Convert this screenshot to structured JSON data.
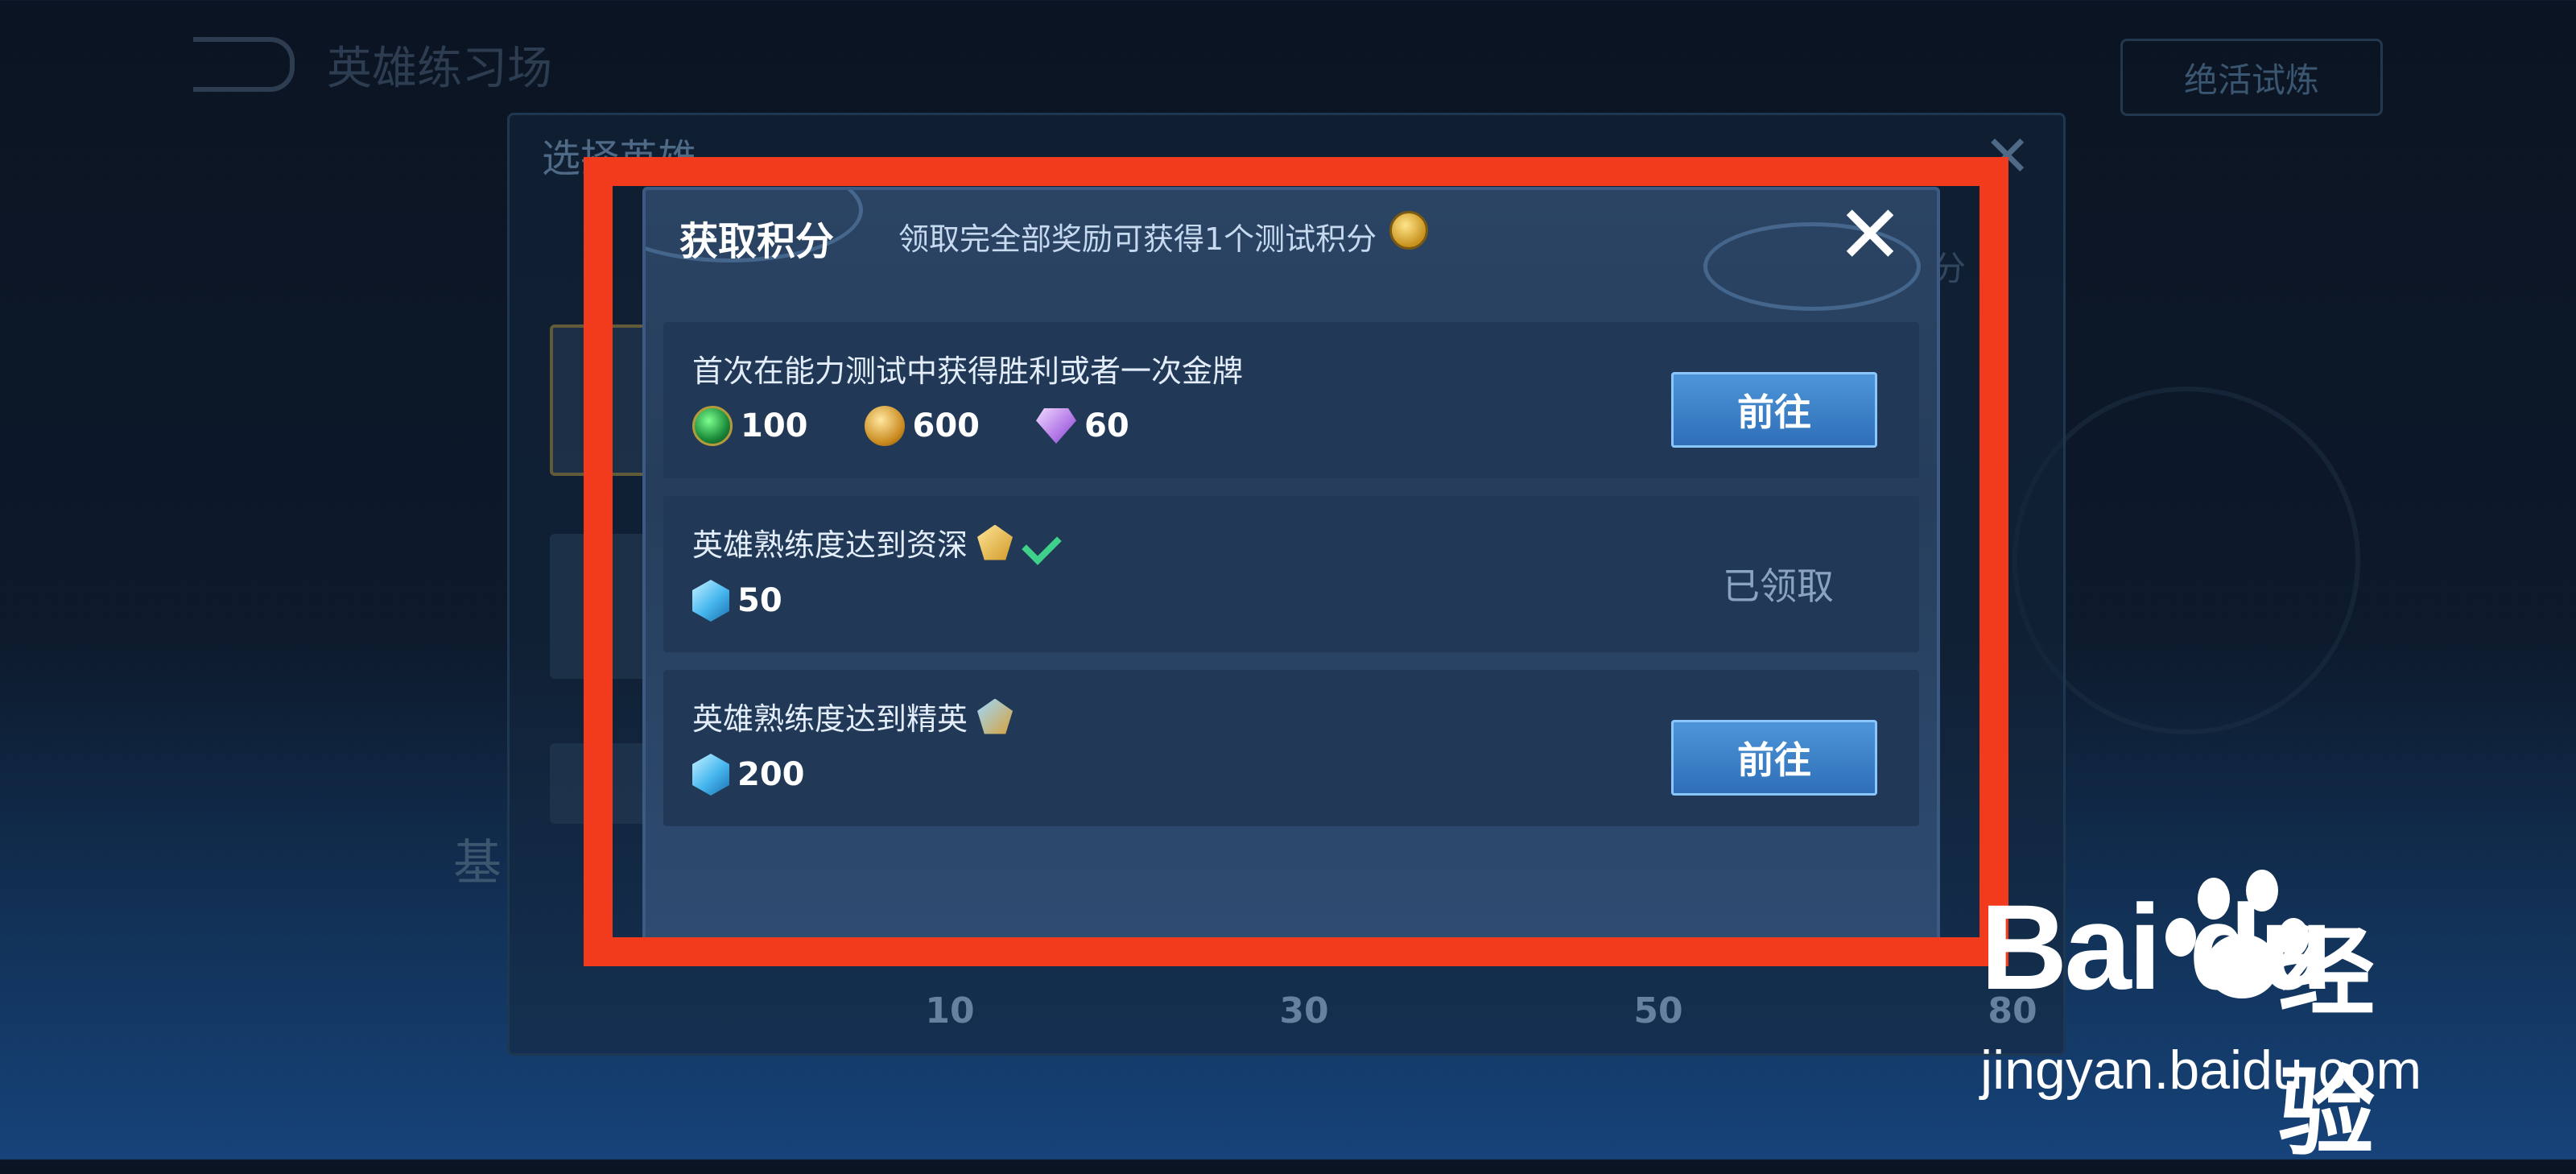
{
  "background": {
    "title": "英雄练习场",
    "top_right_button": "绝活试炼",
    "panel_title": "选择英雄",
    "panel_close": "✕",
    "side_label": "分",
    "bottom_label": "基",
    "progress_ticks": [
      "10",
      "30",
      "50",
      "80"
    ]
  },
  "dialog": {
    "title": "获取积分",
    "subtitle": "领取完全部奖励可获得1个测试积分",
    "close": "✕",
    "tasks": [
      {
        "text": "首次在能力测试中获得胜利或者一次金牌",
        "rewards": [
          {
            "icon": "green-gem-icon",
            "value": "100"
          },
          {
            "icon": "gold-coin-icon",
            "value": "600"
          },
          {
            "icon": "purple-diamond-icon",
            "value": "60"
          }
        ],
        "action": "前往",
        "status": "available"
      },
      {
        "text": "英雄熟练度达到资深",
        "rewards": [
          {
            "icon": "blue-cube-icon",
            "value": "50"
          }
        ],
        "action": "已领取",
        "status": "claimed",
        "completed": true
      },
      {
        "text": "英雄熟练度达到精英",
        "rewards": [
          {
            "icon": "blue-cube-icon",
            "value": "200"
          }
        ],
        "action": "前往",
        "status": "available"
      }
    ]
  },
  "highlight_color": "#f23a1c",
  "watermark": {
    "logo": "Bai du",
    "cn": "经验",
    "url": "jingyan.baidu.com"
  }
}
